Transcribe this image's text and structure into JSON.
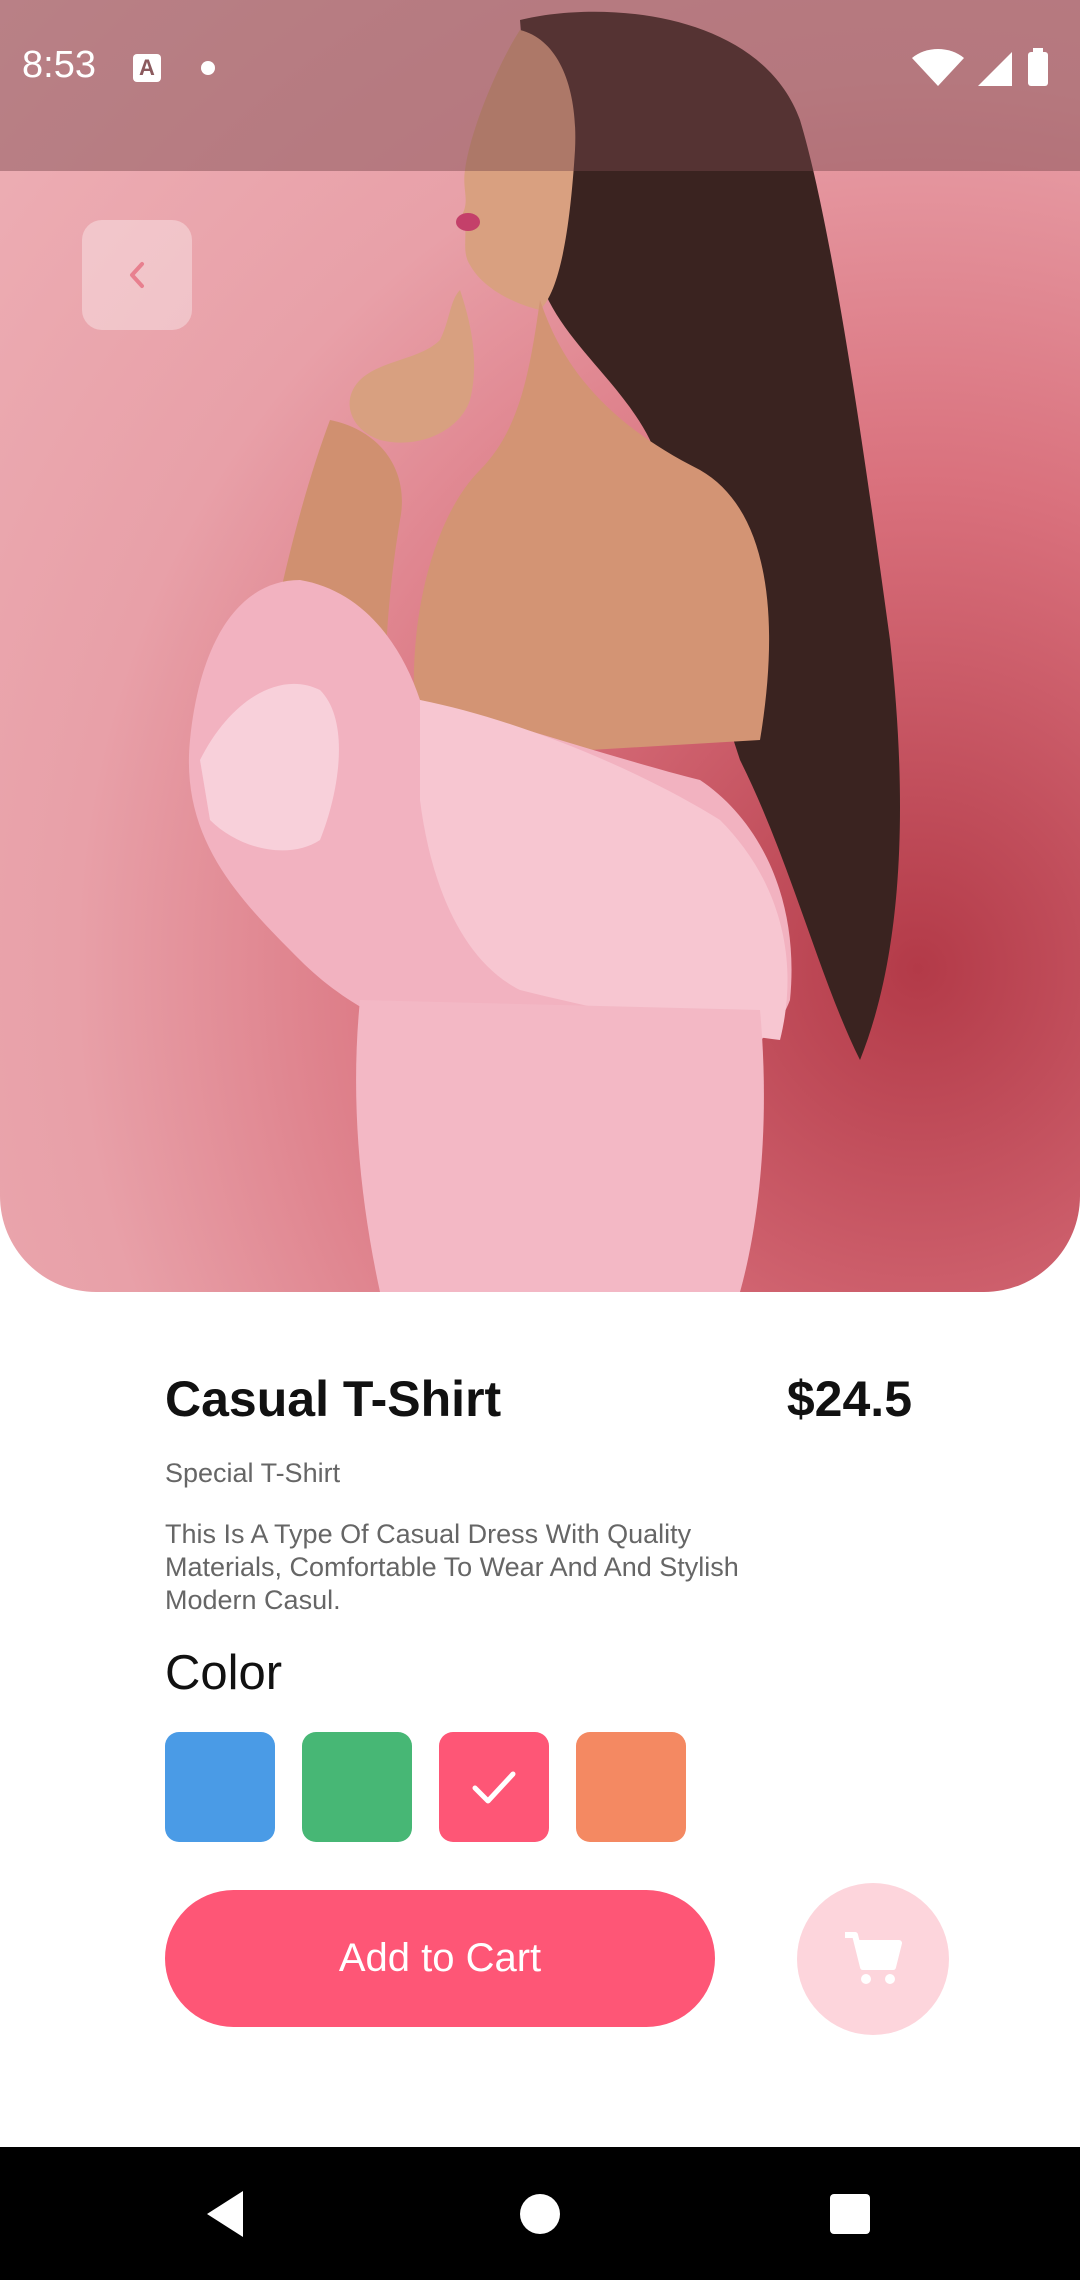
{
  "status_bar": {
    "time": "8:53",
    "icons": [
      "keyboard-a-icon",
      "notification-dot-icon",
      "wifi-icon",
      "cell-signal-icon",
      "battery-icon"
    ]
  },
  "hero": {
    "image": "model-in-pink-ruffled-dress-photo",
    "back_icon": "chevron-left-icon"
  },
  "product": {
    "title": "Casual T-Shirt",
    "price": "$24.5",
    "subtitle": "Special T-Shirt",
    "description": "This Is A Type Of Casual Dress With Quality Materials, Comfortable To Wear And And Stylish Modern Casul."
  },
  "color_section": {
    "heading": "Color",
    "swatches": [
      {
        "color": "#4a9be6",
        "selected": false
      },
      {
        "color": "#47b775",
        "selected": false
      },
      {
        "color": "#fe5676",
        "selected": true
      },
      {
        "color": "#f48962",
        "selected": false
      }
    ]
  },
  "actions": {
    "add_to_cart_label": "Add to Cart",
    "cart_icon": "shopping-cart-icon"
  },
  "colors": {
    "accent": "#fe5676",
    "accent_light": "#fdd5dc",
    "text_primary": "#111111",
    "text_secondary": "#666666"
  },
  "nav_bar": {
    "icons": [
      "nav-back-icon",
      "nav-home-icon",
      "nav-recents-icon"
    ]
  }
}
